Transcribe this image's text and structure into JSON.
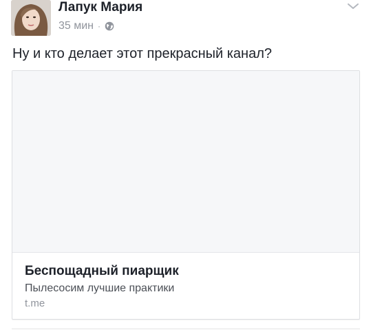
{
  "author": {
    "name": "Лапук Мария",
    "time": "35 мин",
    "separator": "·",
    "privacy_icon": "globe-icon"
  },
  "post": {
    "text": "Ну и кто делает этот прекрасный канал?"
  },
  "link_card": {
    "title": "Беспощадный пиарщик",
    "description": "Пылесосим лучшие практики",
    "domain": "t.me"
  },
  "menu_icon": "chevron-down-icon",
  "colors": {
    "text_primary": "#1d2129",
    "text_secondary": "#90949c",
    "card_border": "#dddfe2",
    "image_placeholder": "#f6f7f9"
  }
}
